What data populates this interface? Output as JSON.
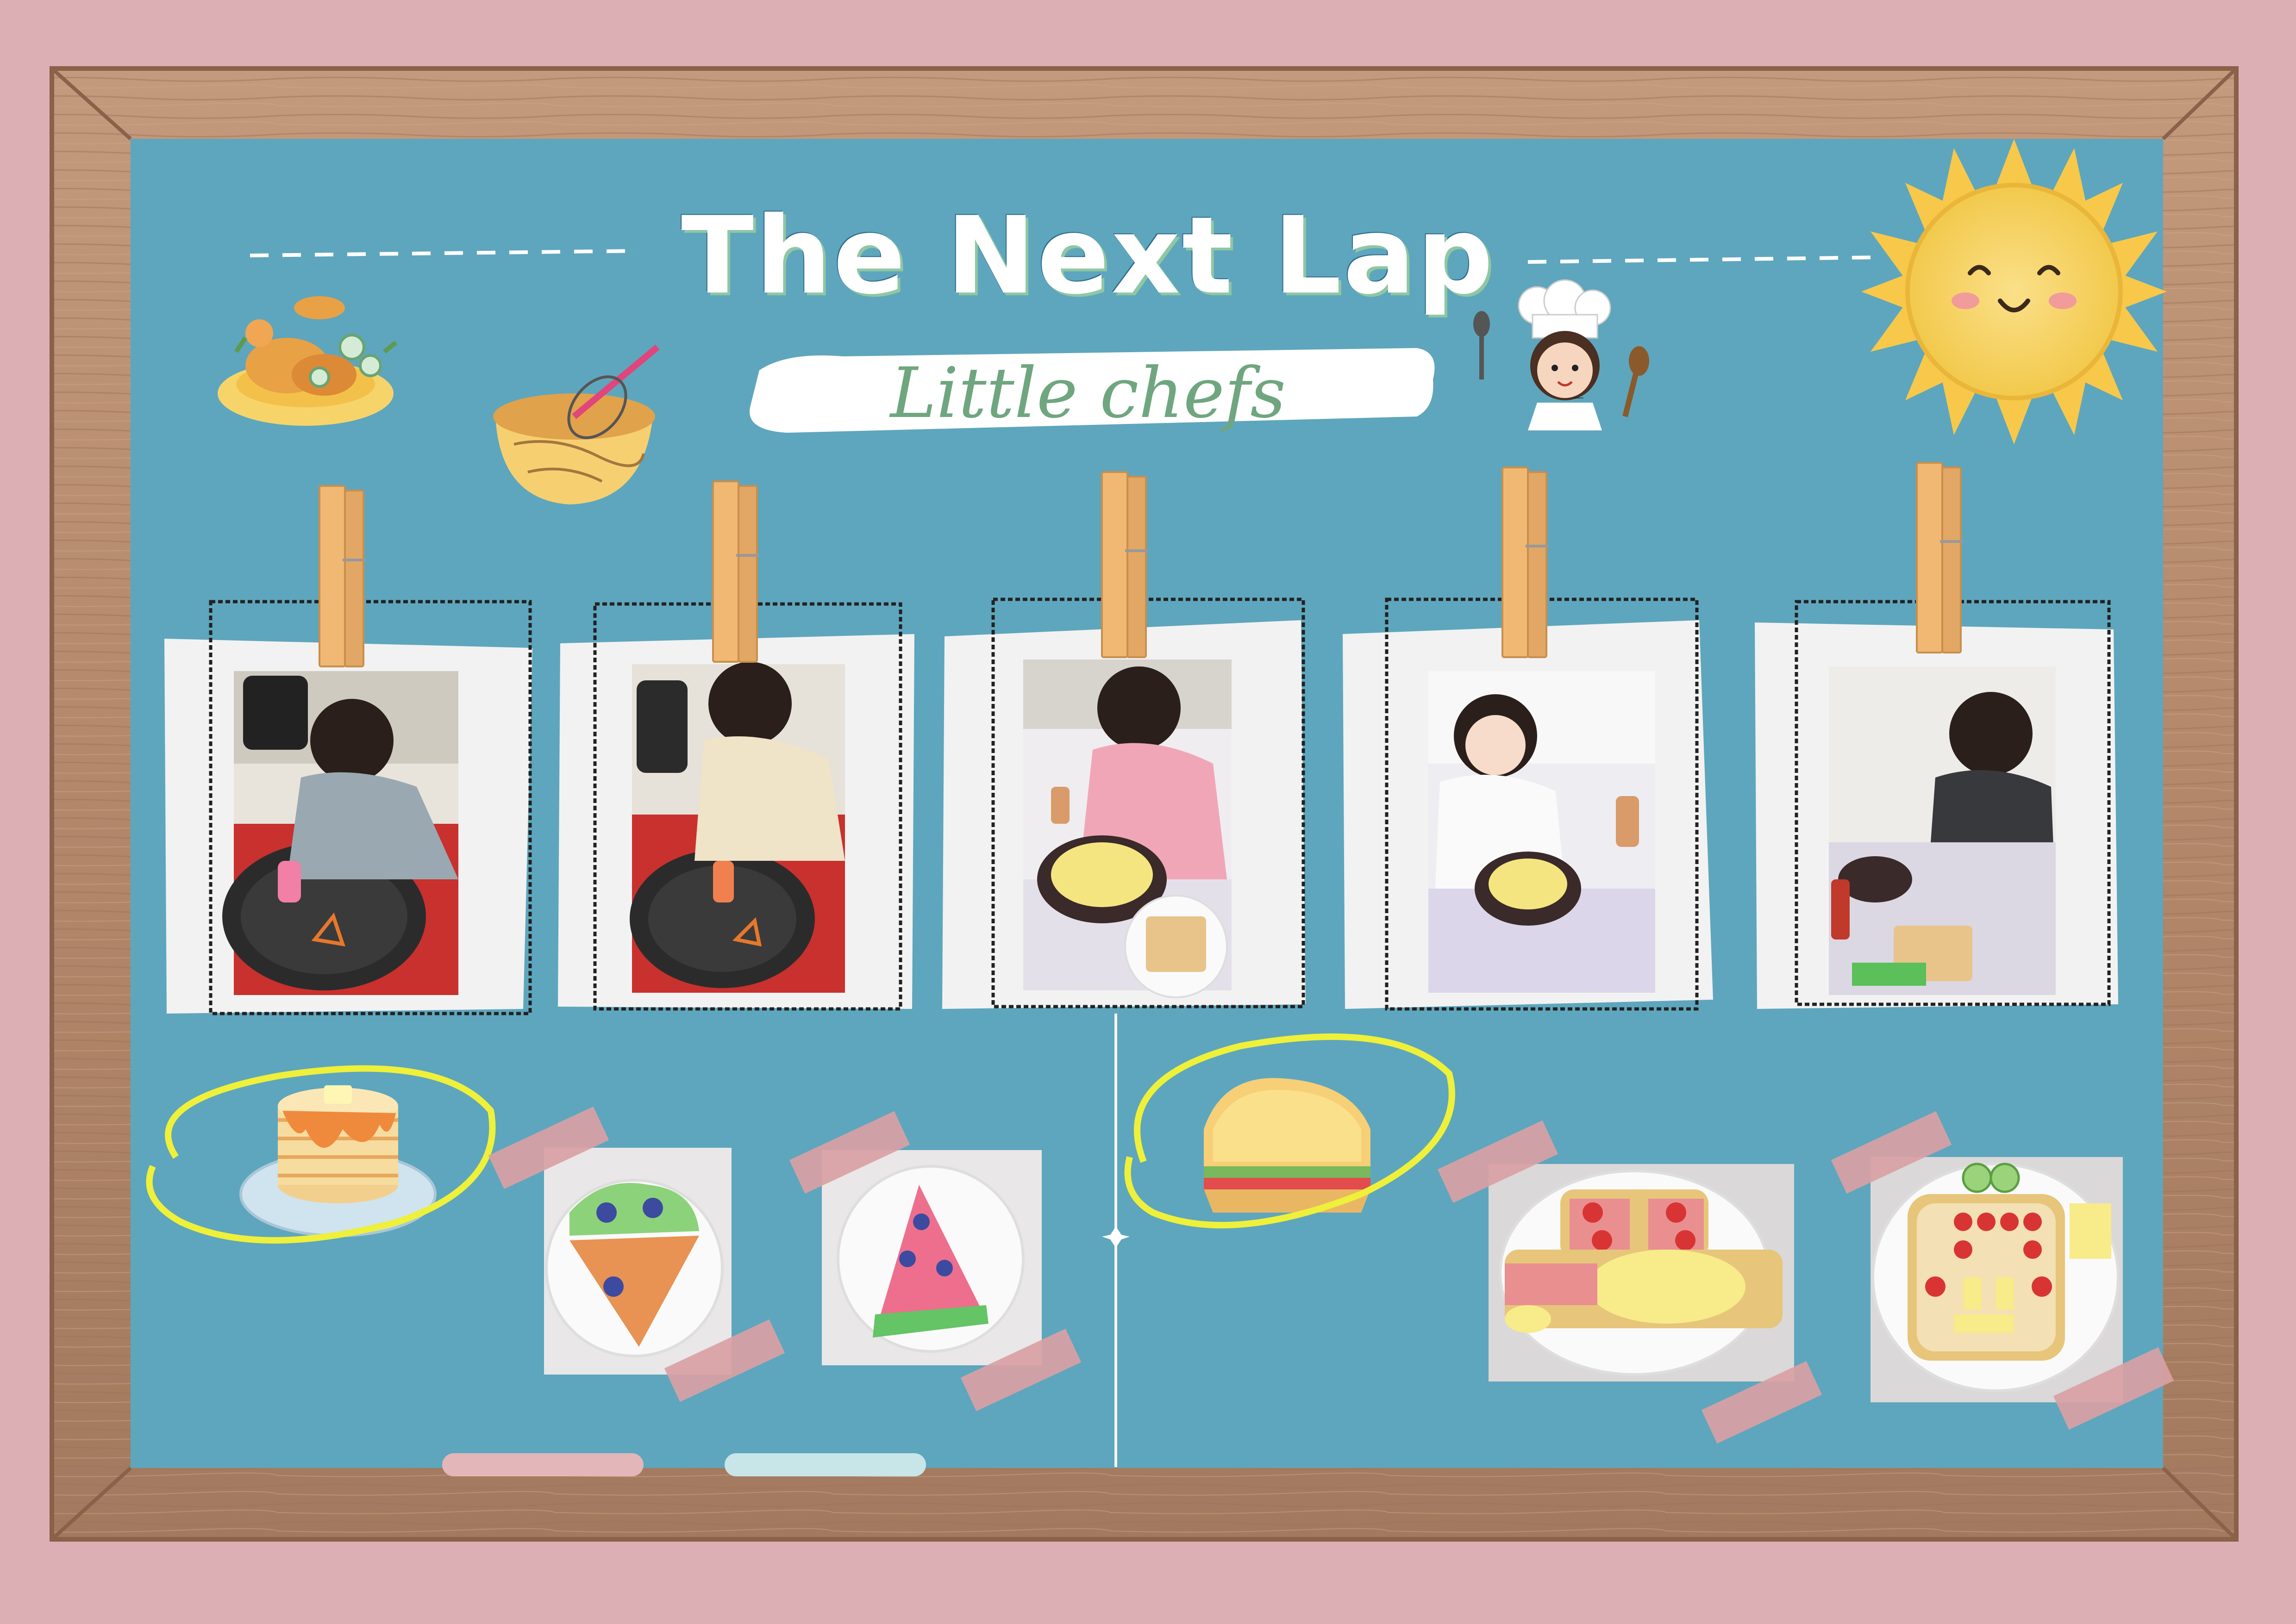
{
  "board": {
    "title": "The Next Lap",
    "subtitle": "Little chefs"
  },
  "colors": {
    "background": "#dcafb5",
    "frame": "#b58b6e",
    "board": "#5ea6bd",
    "sun": "#f7cf57",
    "highlight_circle": "#eef03a",
    "tape": "#d9a1a4",
    "chalk_pink": "#e3b6b9",
    "chalk_blue": "#c8e5e8"
  },
  "icons": {
    "roast_chicken": "roast-chicken-icon",
    "mixing_bowl": "mixing-bowl-icon",
    "chef_girl": "chef-girl-icon",
    "sun": "sun-icon",
    "pancakes": "pancakes-icon",
    "sandwich": "sandwich-icon",
    "clothespin": "clothespin-icon"
  }
}
